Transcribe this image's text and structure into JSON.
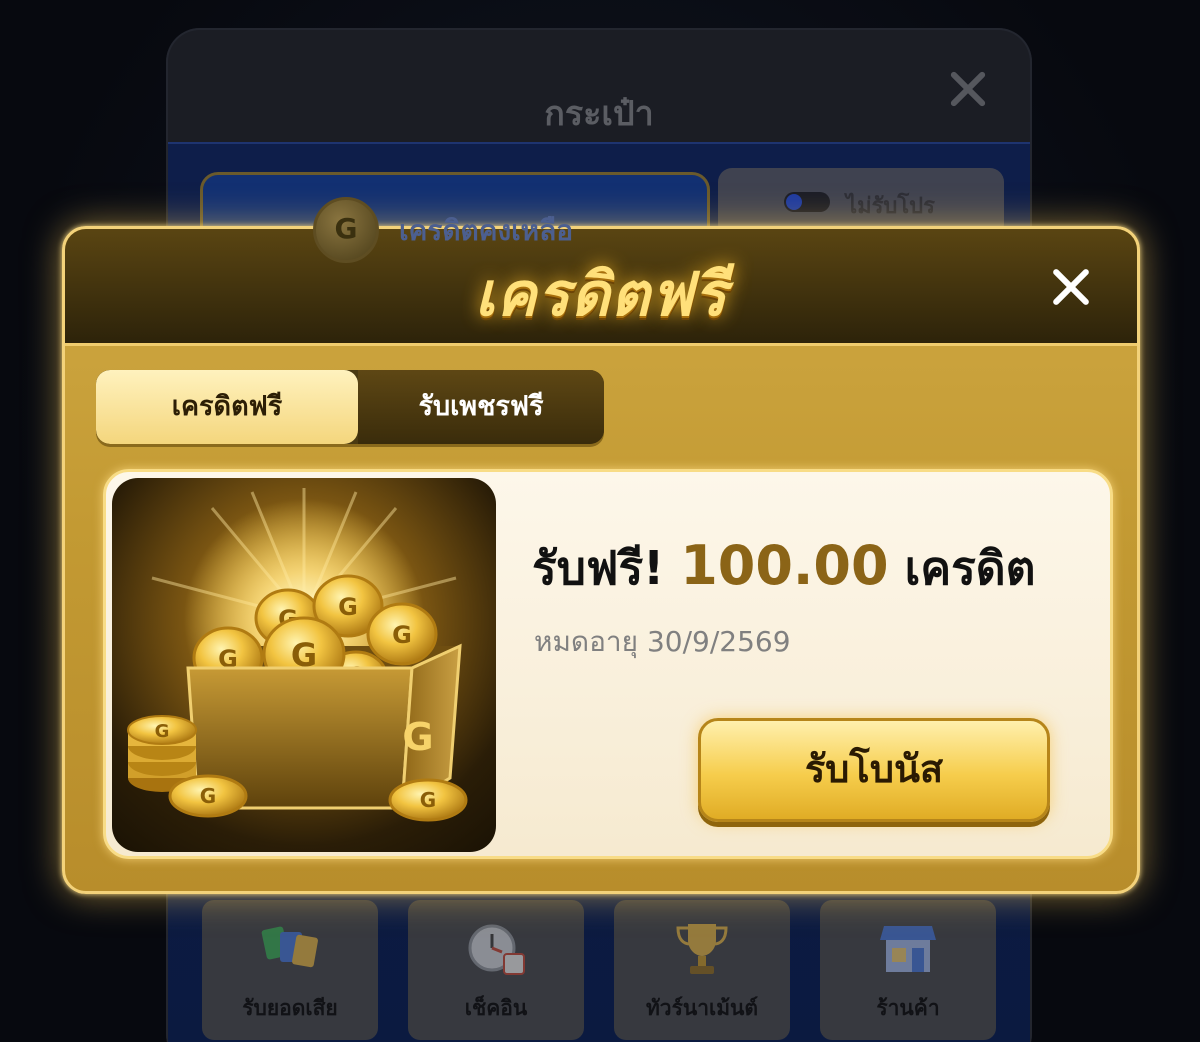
{
  "wallet": {
    "title": "กระเป๋า",
    "credit_label": "เครดิตคงเหลือ",
    "coin_letter": "G",
    "promo_toggle_label": "ไม่รับโปร",
    "shortcuts": [
      {
        "label": "รับยอดเสีย",
        "icon": "cards-icon"
      },
      {
        "label": "เช็คอิน",
        "icon": "clock-calendar-icon"
      },
      {
        "label": "ทัวร์นาเม้นต์",
        "icon": "trophy-icon"
      },
      {
        "label": "ร้านค้า",
        "icon": "shop-icon"
      }
    ]
  },
  "modal": {
    "title": "เครดิตฟรี",
    "tabs": [
      {
        "label": "เครดิตฟรี",
        "active": true
      },
      {
        "label": "รับเพชรฟรี",
        "active": false
      }
    ],
    "reward": {
      "prefix": "รับฟรี!",
      "amount": "100.00",
      "unit": "เครดิต",
      "expiry": "หมดอายุ 30/9/2569",
      "button_label": "รับโบนัส",
      "image": "treasure-box-gold-coins",
      "coin_letter": "G"
    }
  },
  "colors": {
    "gold_accent": "#f3d27a",
    "amount_text": "#8b6417",
    "wallet_blue": "#0e1e4a"
  }
}
